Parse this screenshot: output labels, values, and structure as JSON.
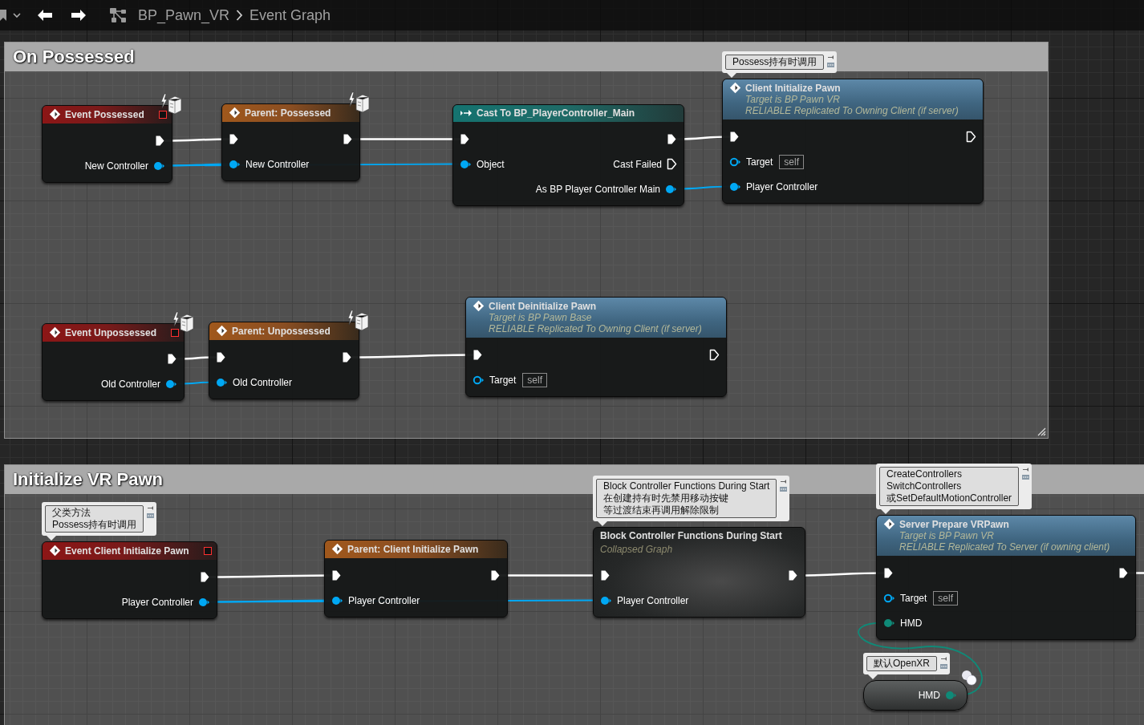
{
  "toolbar": {
    "breadcrumb": [
      "BP_Pawn_VR",
      "Event Graph"
    ]
  },
  "comments": [
    {
      "title": "On Possessed"
    },
    {
      "title": "Initialize VR Pawn"
    }
  ],
  "nodes": [
    {
      "kind": "event",
      "title": "Event Possessed",
      "delegate": true,
      "networked": true,
      "rows": [
        {
          "out": {
            "kind": "exec",
            "connected": true
          }
        },
        {
          "out": {
            "kind": "object",
            "label": "New Controller",
            "connected": true
          }
        }
      ]
    },
    {
      "kind": "parent",
      "title": "Parent: Possessed",
      "networked": true,
      "rows": [
        {
          "in": {
            "kind": "exec",
            "connected": true
          },
          "out": {
            "kind": "exec",
            "connected": true
          }
        },
        {
          "in": {
            "kind": "object",
            "label": "New Controller",
            "connected": true
          }
        }
      ]
    },
    {
      "kind": "cast",
      "title": "Cast To BP_PlayerController_Main",
      "rows": [
        {
          "in": {
            "kind": "exec",
            "connected": true
          },
          "out": {
            "kind": "exec",
            "connected": true
          }
        },
        {
          "in": {
            "kind": "object",
            "label": "Object",
            "connected": true
          },
          "out": {
            "kind": "exec",
            "label": "Cast Failed",
            "connected": false
          }
        },
        {
          "out": {
            "kind": "object",
            "label": "As BP Player Controller Main",
            "connected": true
          }
        }
      ]
    },
    {
      "kind": "function",
      "title": "Client Initialize Pawn",
      "subtitle": [
        "Target is BP Pawn VR",
        "RELIABLE Replicated To Owning Client (if server)"
      ],
      "comment": [
        "Possess持有时调用"
      ],
      "rows": [
        {
          "in": {
            "kind": "exec",
            "connected": true
          },
          "out": {
            "kind": "exec",
            "connected": false
          }
        },
        {
          "in": {
            "kind": "object",
            "label": "Target",
            "default": "self",
            "connected": false
          }
        },
        {
          "in": {
            "kind": "object",
            "label": "Player Controller",
            "connected": true
          }
        }
      ]
    },
    {
      "kind": "event",
      "title": "Event Unpossessed",
      "delegate": true,
      "networked": true,
      "rows": [
        {
          "out": {
            "kind": "exec",
            "connected": true
          }
        },
        {
          "out": {
            "kind": "object",
            "label": "Old Controller",
            "connected": true
          }
        }
      ]
    },
    {
      "kind": "parent",
      "title": "Parent: Unpossessed",
      "networked": true,
      "rows": [
        {
          "in": {
            "kind": "exec",
            "connected": true
          },
          "out": {
            "kind": "exec",
            "connected": true
          }
        },
        {
          "in": {
            "kind": "object",
            "label": "Old Controller",
            "connected": true
          }
        }
      ]
    },
    {
      "kind": "function",
      "title": "Client Deinitialize Pawn",
      "subtitle": [
        "Target is BP Pawn Base",
        "RELIABLE Replicated To Owning Client (if server)"
      ],
      "rows": [
        {
          "in": {
            "kind": "exec",
            "connected": true
          },
          "out": {
            "kind": "exec",
            "connected": false
          }
        },
        {
          "in": {
            "kind": "object",
            "label": "Target",
            "default": "self",
            "connected": false
          }
        }
      ]
    },
    {
      "kind": "event",
      "title": "Event Client Initialize Pawn",
      "delegate": true,
      "comment": [
        "父类方法",
        "Possess持有时调用"
      ],
      "rows": [
        {
          "out": {
            "kind": "exec",
            "connected": true
          }
        },
        {
          "out": {
            "kind": "object",
            "label": "Player Controller",
            "connected": true
          }
        }
      ]
    },
    {
      "kind": "parent",
      "title": "Parent: Client Initialize Pawn",
      "rows": [
        {
          "in": {
            "kind": "exec",
            "connected": true
          },
          "out": {
            "kind": "exec",
            "connected": true
          }
        },
        {
          "in": {
            "kind": "object",
            "label": "Player Controller",
            "connected": true
          }
        }
      ]
    },
    {
      "kind": "collapsed",
      "title": "Block Controller Functions During Start",
      "subtitle": [
        "Collapsed Graph"
      ],
      "comment": [
        "Block Controller Functions During Start",
        "在创建持有时先禁用移动按键",
        "等过渡结束再调用解除限制"
      ],
      "rows": [
        {
          "in": {
            "kind": "exec",
            "connected": true
          },
          "out": {
            "kind": "exec",
            "connected": true
          }
        },
        {
          "in": {
            "kind": "object",
            "label": "Player Controller",
            "connected": true
          }
        }
      ]
    },
    {
      "kind": "function",
      "title": "Server Prepare VRPawn",
      "subtitle": [
        "Target is BP Pawn VR",
        "RELIABLE Replicated To Server (if owning client)"
      ],
      "comment": [
        "CreateControllers",
        "SwitchControllers",
        "或SetDefaultMotionController"
      ],
      "rows": [
        {
          "in": {
            "kind": "exec",
            "connected": true
          },
          "out": {
            "kind": "exec",
            "connected": true
          }
        },
        {
          "in": {
            "kind": "object",
            "label": "Target",
            "default": "self",
            "connected": false
          }
        },
        {
          "in": {
            "kind": "struct",
            "label": "HMD",
            "connected": true
          }
        }
      ]
    },
    {
      "kind": "variable",
      "comment": [
        "默认OpenXR"
      ],
      "rows": [
        {
          "out": {
            "kind": "struct",
            "label": "HMD",
            "connected": true
          }
        }
      ]
    }
  ]
}
